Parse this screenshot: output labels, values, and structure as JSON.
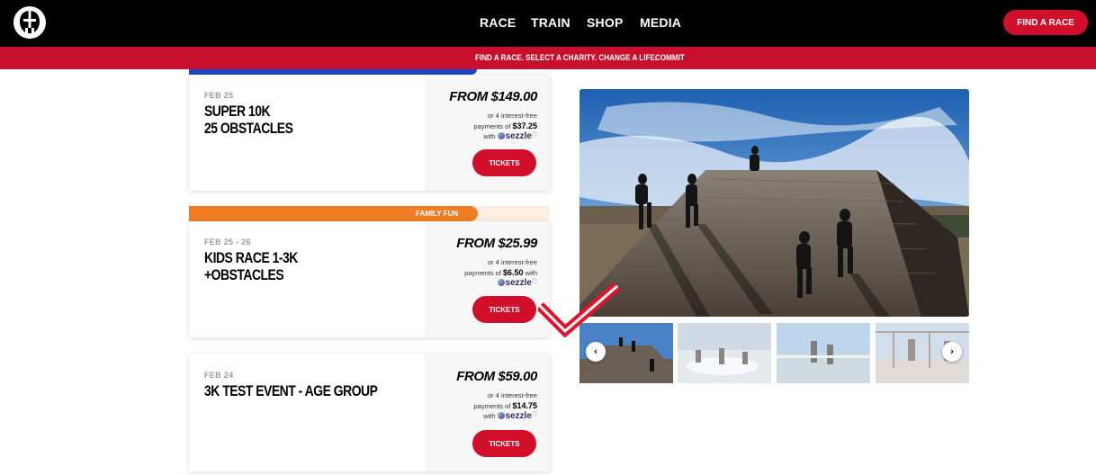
{
  "header": {
    "logo_icon": "spartan-helmet-icon",
    "nav": [
      "RACE",
      "TRAIN",
      "SHOP",
      "MEDIA"
    ],
    "find_race_button": "FIND A RACE"
  },
  "banner": {
    "message": "FIND A RACE. SELECT A CHARITY. CHANGE A LIFE.",
    "link": "COMMIT"
  },
  "events": [
    {
      "date": "FEB 25",
      "name_lines": [
        "SUPER 10K",
        "25 OBSTACLES"
      ],
      "price": "FROM $149.00",
      "pay_line1": "or 4 interest-free",
      "pay_prefix": "payments of",
      "installment": "$37.25",
      "pay_with": "with",
      "provider": "sezzle",
      "tickets_label": "TICKETS"
    },
    {
      "ribbon": "FAMILY FUN",
      "date": "FEB 25 - 26",
      "name_lines": [
        "KIDS RACE 1-3K",
        "+OBSTACLES"
      ],
      "price": "FROM $25.99",
      "pay_line1": "or 4 interest-free",
      "pay_prefix": "payments of",
      "installment": "$6.50",
      "pay_with": "with",
      "provider": "sezzle",
      "tickets_label": "TICKETS"
    },
    {
      "date": "FEB 24",
      "name_lines": [
        "3K TEST EVENT - AGE GROUP"
      ],
      "price": "FROM $59.00",
      "pay_line1": "or 4 interest-free",
      "pay_prefix": "payments of",
      "installment": "$14.75",
      "pay_with": "with",
      "provider": "sezzle",
      "tickets_label": "TICKETS"
    }
  ],
  "gallery": {
    "prev_icon": "chevron-left-icon",
    "next_icon": "chevron-right-icon",
    "prev_glyph": "‹",
    "next_glyph": "›",
    "thumbnail_count": 4,
    "selected_thumbnail": 1
  },
  "annotation": {
    "icon": "check-mark-icon",
    "color": "#e3132b"
  },
  "colors": {
    "brand_red": "#d20f2b",
    "banner_red": "#c8102e",
    "ribbon_orange": "#f07c24",
    "ribbon_blue": "#1e44c8"
  }
}
